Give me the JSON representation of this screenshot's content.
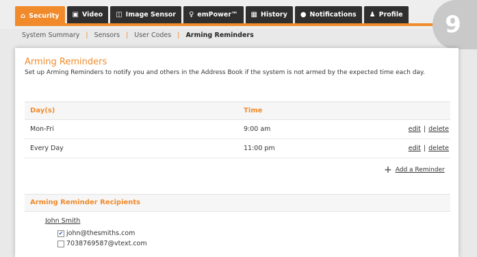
{
  "tabs": [
    {
      "label": "Security",
      "icon": "home-icon",
      "active": true
    },
    {
      "label": "Video",
      "icon": "video-icon"
    },
    {
      "label": "Image Sensor",
      "icon": "camera-icon"
    },
    {
      "label": "emPower™",
      "icon": "lightbulb-icon"
    },
    {
      "label": "History",
      "icon": "calendar-icon"
    },
    {
      "label": "Notifications",
      "icon": "chat-icon"
    },
    {
      "label": "Profile",
      "icon": "person-icon"
    }
  ],
  "subnav": [
    "System Summary",
    "Sensors",
    "User Codes",
    "Arming Reminders"
  ],
  "badge": "9",
  "panel": {
    "title": "Arming Reminders",
    "description": "Set up Arming Reminders to notify you and others in the Address Book if the system is not armed by the expected time each day.",
    "table": {
      "headers": {
        "day": "Day(s)",
        "time": "Time"
      },
      "rows": [
        {
          "day": "Mon-Fri",
          "time": "9:00 am",
          "edit": "edit",
          "delete": "delete"
        },
        {
          "day": "Every Day",
          "time": "11:00 pm",
          "edit": "edit",
          "delete": "delete"
        }
      ]
    },
    "add_reminder": "Add a Reminder",
    "recipients": {
      "title": "Arming Reminder Recipients",
      "name": "John Smith",
      "options": [
        {
          "label": "john@thesmiths.com",
          "checked": true
        },
        {
          "label": "7038769587@vtext.com",
          "checked": false
        }
      ]
    }
  },
  "colors": {
    "accent": "#f08a2b",
    "tab_bg": "#2f2f2f"
  }
}
